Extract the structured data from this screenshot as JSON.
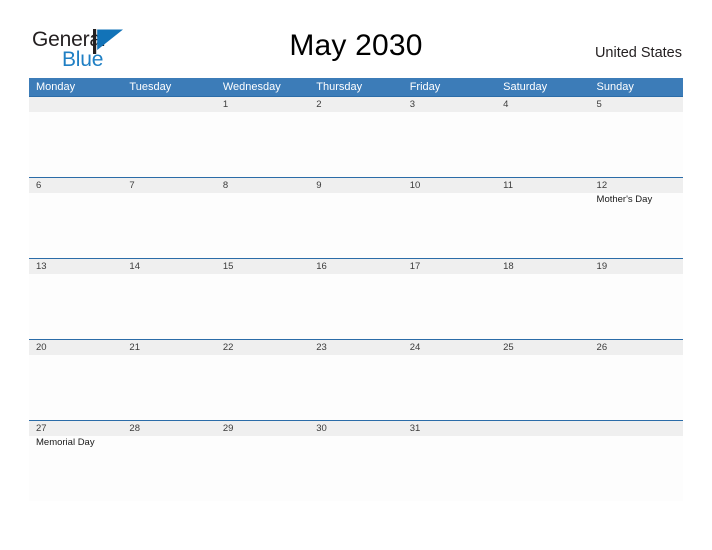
{
  "brand": {
    "name_part1": "General",
    "name_part2": "Blue",
    "flag_icon": "blue-pennant-flag-icon",
    "color_dark": "#231f20",
    "color_blue": "#1f7fc4"
  },
  "header": {
    "title": "May 2030",
    "country": "United States"
  },
  "theme": {
    "header_blue": "#3c7cb8",
    "row_border_blue": "#2b6ca8",
    "date_band_gray": "#efefef",
    "cell_white": "#fdfdfd"
  },
  "calendar": {
    "weekdays": [
      "Monday",
      "Tuesday",
      "Wednesday",
      "Thursday",
      "Friday",
      "Saturday",
      "Sunday"
    ],
    "weeks": [
      {
        "days": [
          {
            "number": "",
            "events": []
          },
          {
            "number": "",
            "events": []
          },
          {
            "number": "1",
            "events": []
          },
          {
            "number": "2",
            "events": []
          },
          {
            "number": "3",
            "events": []
          },
          {
            "number": "4",
            "events": []
          },
          {
            "number": "5",
            "events": []
          }
        ]
      },
      {
        "days": [
          {
            "number": "6",
            "events": []
          },
          {
            "number": "7",
            "events": []
          },
          {
            "number": "8",
            "events": []
          },
          {
            "number": "9",
            "events": []
          },
          {
            "number": "10",
            "events": []
          },
          {
            "number": "11",
            "events": []
          },
          {
            "number": "12",
            "events": [
              "Mother's Day"
            ]
          }
        ]
      },
      {
        "days": [
          {
            "number": "13",
            "events": []
          },
          {
            "number": "14",
            "events": []
          },
          {
            "number": "15",
            "events": []
          },
          {
            "number": "16",
            "events": []
          },
          {
            "number": "17",
            "events": []
          },
          {
            "number": "18",
            "events": []
          },
          {
            "number": "19",
            "events": []
          }
        ]
      },
      {
        "days": [
          {
            "number": "20",
            "events": []
          },
          {
            "number": "21",
            "events": []
          },
          {
            "number": "22",
            "events": []
          },
          {
            "number": "23",
            "events": []
          },
          {
            "number": "24",
            "events": []
          },
          {
            "number": "25",
            "events": []
          },
          {
            "number": "26",
            "events": []
          }
        ]
      },
      {
        "days": [
          {
            "number": "27",
            "events": [
              "Memorial Day"
            ]
          },
          {
            "number": "28",
            "events": []
          },
          {
            "number": "29",
            "events": []
          },
          {
            "number": "30",
            "events": []
          },
          {
            "number": "31",
            "events": []
          },
          {
            "number": "",
            "events": []
          },
          {
            "number": "",
            "events": []
          }
        ]
      }
    ]
  }
}
